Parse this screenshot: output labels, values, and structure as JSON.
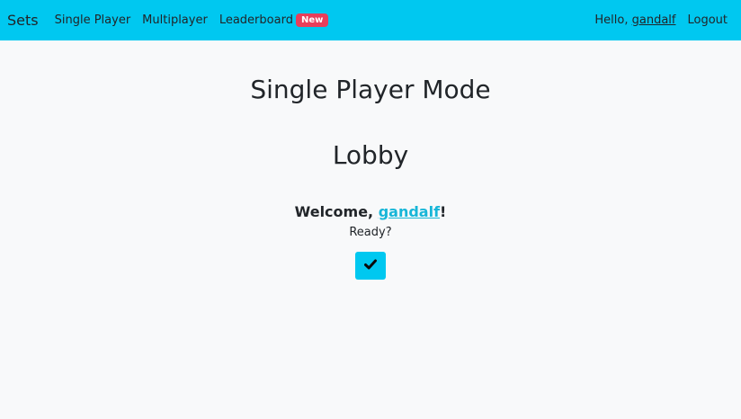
{
  "nav": {
    "brand": "Sets",
    "links": [
      "Single Player",
      "Multiplayer",
      "Leaderboard"
    ],
    "badge": "New",
    "hello_prefix": "Hello, ",
    "username": "gandalf",
    "logout": "Logout"
  },
  "main": {
    "title": "Single Player Mode",
    "subtitle": "Lobby",
    "welcome_prefix": "Welcome, ",
    "username": "gandalf",
    "welcome_suffix": "!",
    "ready_text": "Ready?",
    "ready_button_icon": "check-icon"
  },
  "colors": {
    "navbar": "#00c8f0",
    "badge": "#e83e5a",
    "link": "#17b6d8",
    "background": "#f8f9fa"
  }
}
